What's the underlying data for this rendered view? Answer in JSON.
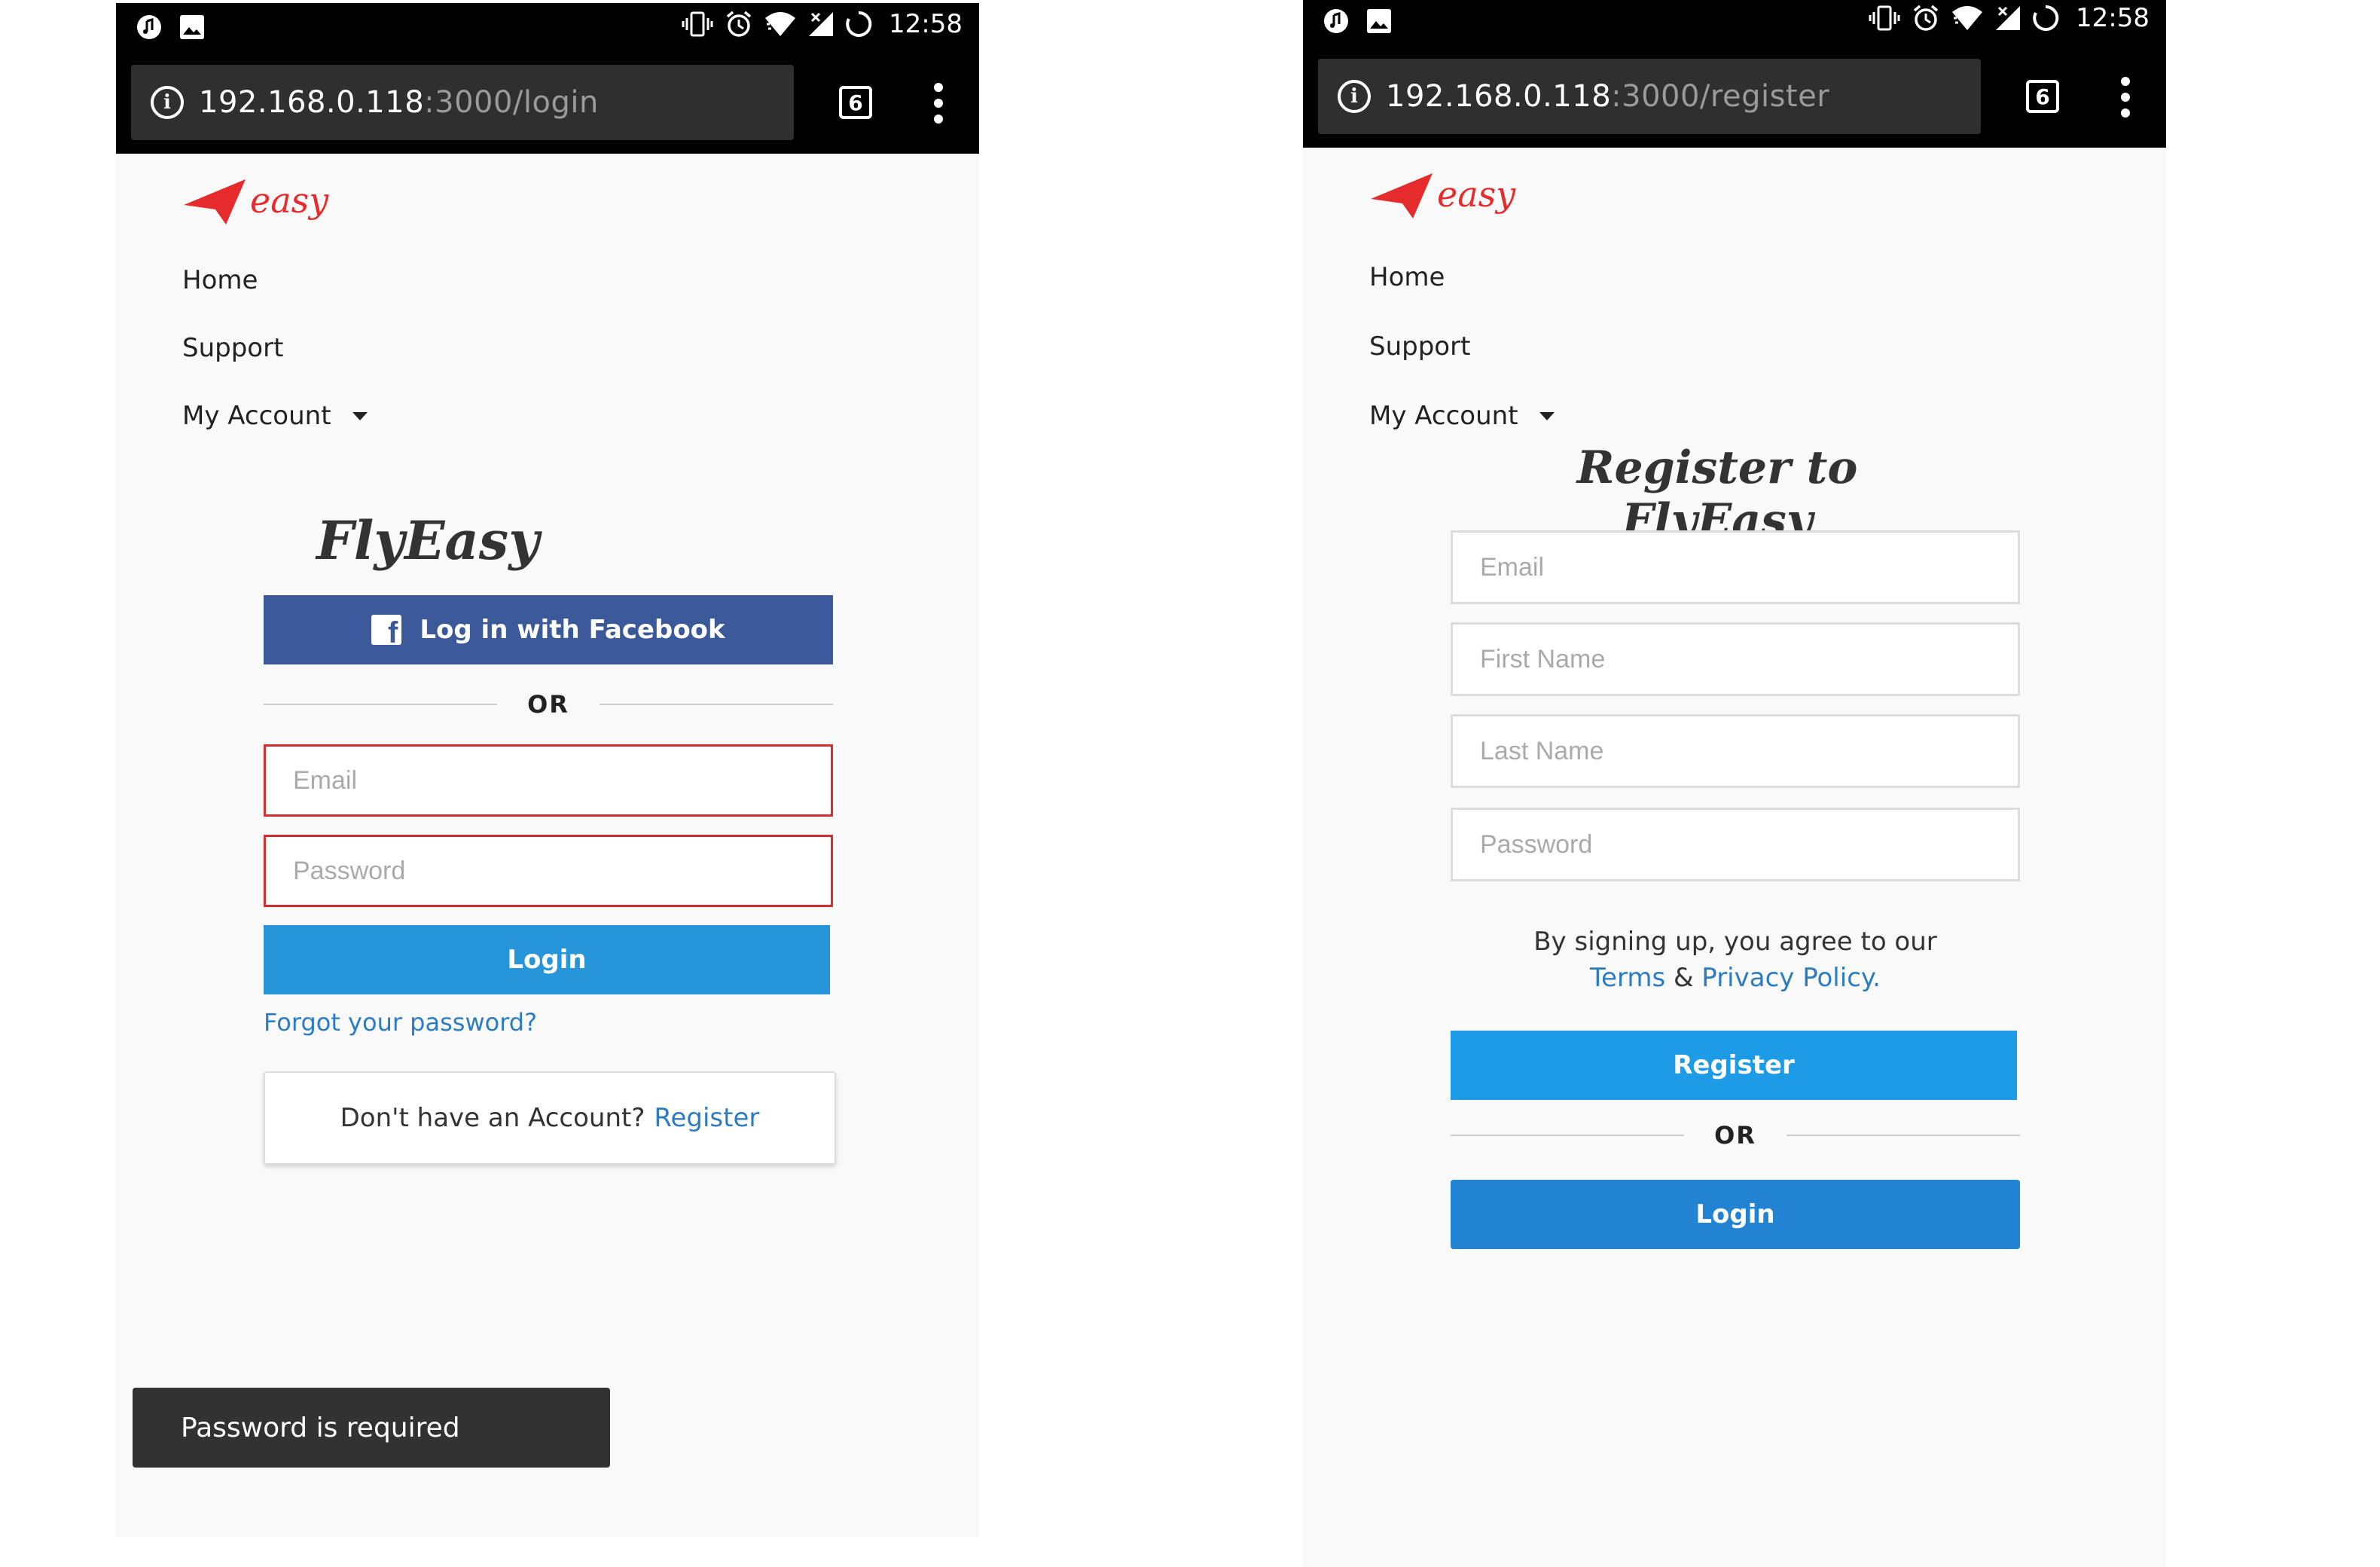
{
  "colors": {
    "facebook_blue": "#3b5998",
    "login_blue": "#2795d9",
    "register_blue": "#1d9be6",
    "link_blue": "#2d7cc1",
    "error_red": "#d32f2f",
    "logo_red": "#e52b2b",
    "snackbar": "#323232"
  },
  "status_bar": {
    "time": "12:58",
    "icons": [
      "music-app-icon",
      "image-icon",
      "vibrate-icon",
      "alarm-icon",
      "wifi-icon",
      "signal-icon",
      "sync-icon"
    ]
  },
  "left_screen": {
    "url_host": "192.168.0.118",
    "url_path": ":3000/login",
    "tab_count": "6",
    "logo_text": "easy",
    "nav": {
      "home": "Home",
      "support": "Support",
      "my_account": "My Account"
    },
    "brand_title": "FlyEasy",
    "facebook_button": "Log in with Facebook",
    "or_label": "OR",
    "email_placeholder": "Email",
    "password_placeholder": "Password",
    "login_button": "Login",
    "forgot_password": "Forgot your password?",
    "no_account_text": "Don't have an Account?",
    "register_link": "Register",
    "snackbar_message": "Password is required"
  },
  "right_screen": {
    "url_host": "192.168.0.118",
    "url_path": ":3000/register",
    "tab_count": "6",
    "logo_text": "easy",
    "nav": {
      "home": "Home",
      "support": "Support",
      "my_account": "My Account"
    },
    "register_title": "Register to FlyEasy",
    "email_placeholder": "Email",
    "first_name_placeholder": "First Name",
    "last_name_placeholder": "Last Name",
    "password_placeholder": "Password",
    "terms_prefix": "By signing up, you agree to our",
    "terms_link": "Terms",
    "ampersand": "&",
    "privacy_link": "Privacy Policy.",
    "register_button": "Register",
    "or_label": "OR",
    "login_button": "Login"
  }
}
